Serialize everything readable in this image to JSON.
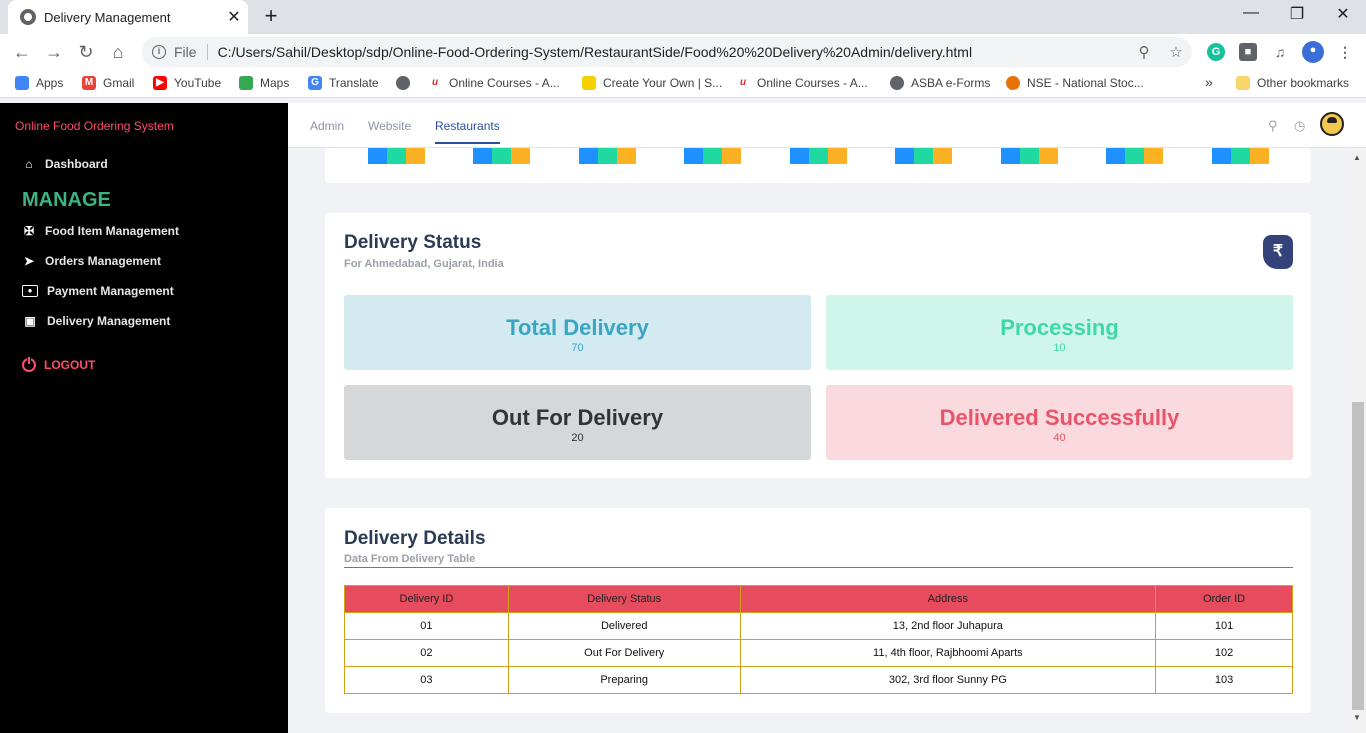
{
  "browser": {
    "tab_title": "Delivery Management",
    "tab_close": "✕",
    "new_tab": "+",
    "scheme": "File",
    "url": "C:/Users/Sahil/Desktop/sdp/Online-Food-Ordering-System/RestaurantSide/Food%20%20Delivery%20Admin/delivery.html",
    "bookmarks": [
      {
        "label": "Apps",
        "color": "#4285f4"
      },
      {
        "label": "Gmail",
        "color": "#ea4335"
      },
      {
        "label": "YouTube",
        "color": "#ff0000"
      },
      {
        "label": "Maps",
        "color": "#34a853"
      },
      {
        "label": "Translate",
        "color": "#4285f4"
      },
      {
        "label": "Online Courses - A...",
        "color": "#d32f2f"
      },
      {
        "label": "Create Your Own | S...",
        "color": "#f7d000"
      },
      {
        "label": "Online Courses - A...",
        "color": "#d32f2f"
      },
      {
        "label": "ASBA e-Forms",
        "color": "#5f6368"
      },
      {
        "label": "NSE - National Stoc...",
        "color": "#e8710a"
      },
      {
        "label": "Other bookmarks",
        "color": "#f9d66b"
      }
    ],
    "overflow": "»"
  },
  "sidebar": {
    "brand": "Online Food Ordering System",
    "dashboard": "Dashboard",
    "manage_title": "MANAGE",
    "items": [
      {
        "label": "Food Item Management",
        "icon": "utensils-icon"
      },
      {
        "label": "Orders Management",
        "icon": "rocket-icon"
      },
      {
        "label": "Payment Management",
        "icon": "money-icon"
      },
      {
        "label": "Delivery Management",
        "icon": "car-icon"
      }
    ],
    "logout": "LOGOUT"
  },
  "topnav": {
    "links": [
      "Admin",
      "Website",
      "Restaurants"
    ],
    "active": "Restaurants"
  },
  "status_card": {
    "title": "Delivery Status",
    "subtitle": "For Ahmedabad, Gujarat, India",
    "badge": "₹",
    "stats": [
      {
        "label": "Total Delivery",
        "value": "70",
        "color": "#3ba6c4",
        "bg": "#d2eaf0"
      },
      {
        "label": "Processing",
        "value": "10",
        "color": "#3ed9a6",
        "bg": "#d0f5ea"
      },
      {
        "label": "Out For Delivery",
        "value": "20",
        "color": "#333333",
        "bg": "#d6d7d9"
      },
      {
        "label": "Delivered Successfully",
        "value": "40",
        "color": "#e8546a",
        "bg": "#fadadf"
      }
    ]
  },
  "details_card": {
    "title": "Delivery Details",
    "subtitle": "Data From Delivery Table",
    "columns": [
      "Delivery ID",
      "Delivery Status",
      "Address",
      "Order ID"
    ],
    "rows": [
      [
        "01",
        "Delivered",
        "13, 2nd floor Juhapura",
        "101"
      ],
      [
        "02",
        "Out For Delivery",
        "11, 4th floor, Rajbhoomi Aparts",
        "102"
      ],
      [
        "03",
        "Preparing",
        "302, 3rd floor Sunny PG",
        "103"
      ]
    ]
  },
  "colors": {
    "square_blue": "#1e90ff",
    "square_green": "#20d9a0",
    "square_orange": "#fbb123"
  }
}
